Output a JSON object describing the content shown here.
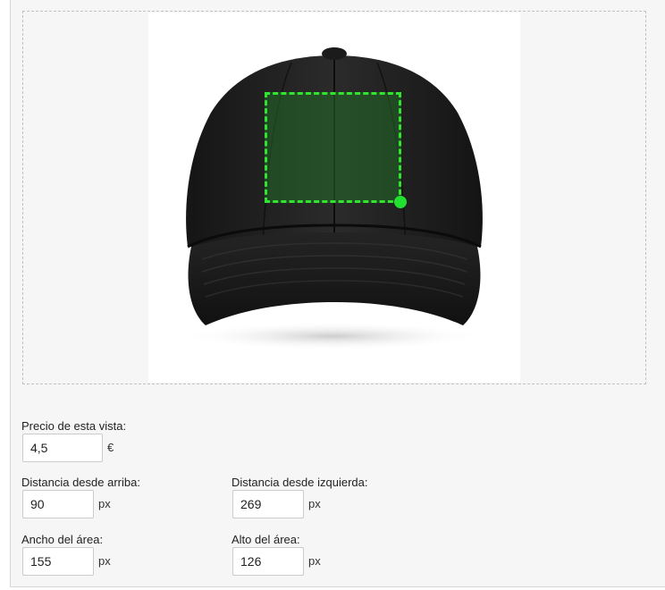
{
  "editor": {
    "product_image": "black-baseball-cap",
    "print_area_color": "#31e52f"
  },
  "form": {
    "price": {
      "label": "Precio de esta vista:",
      "value": "4,5",
      "unit": "€"
    },
    "top": {
      "label": "Distancia desde arriba:",
      "value": "90",
      "unit": "px"
    },
    "left": {
      "label": "Distancia desde izquierda:",
      "value": "269",
      "unit": "px"
    },
    "width": {
      "label": "Ancho del área:",
      "value": "155",
      "unit": "px"
    },
    "height": {
      "label": "Alto del área:",
      "value": "126",
      "unit": "px"
    }
  }
}
